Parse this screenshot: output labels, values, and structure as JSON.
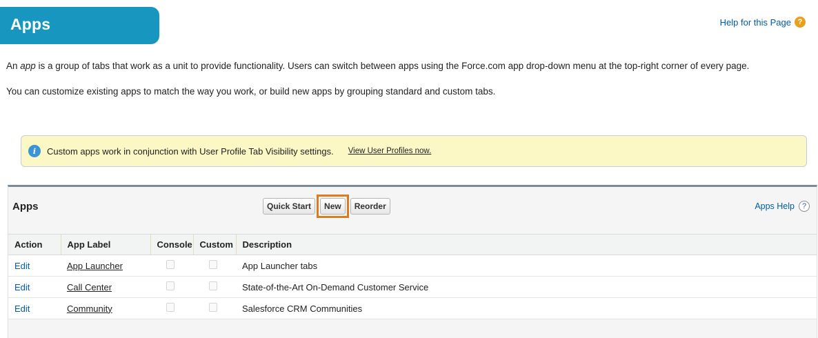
{
  "header": {
    "title": "Apps",
    "help_link": "Help for this Page",
    "help_icon": "question-orange-icon"
  },
  "intro": {
    "line1_prefix": "An ",
    "line1_em": "app",
    "line1_suffix": " is a group of tabs that work as a unit to provide functionality. Users can switch between apps using the Force.com app drop-down menu at the top-right corner of every page.",
    "line2": "You can customize existing apps to match the way you work, or build new apps by grouping standard and custom tabs."
  },
  "info": {
    "icon": "info-icon",
    "text": "Custom apps work in conjunction with User Profile Tab Visibility settings.",
    "link": "View User Profiles now."
  },
  "panel": {
    "title": "Apps",
    "buttons": {
      "quick_start": "Quick Start",
      "new": "New",
      "reorder": "Reorder"
    },
    "help_link": "Apps Help",
    "help_icon": "question-circle-icon",
    "highlight_color": "#e07a1f"
  },
  "table": {
    "columns": [
      "Action",
      "App Label",
      "Console",
      "Custom",
      "Description"
    ],
    "rows": [
      {
        "action": "Edit",
        "label": "App Launcher",
        "console": false,
        "custom": false,
        "description": "App Launcher tabs"
      },
      {
        "action": "Edit",
        "label": "Call Center",
        "console": false,
        "custom": false,
        "description": "State-of-the-Art On-Demand Customer Service"
      },
      {
        "action": "Edit",
        "label": "Community",
        "console": false,
        "custom": false,
        "description": "Salesforce CRM Communities"
      }
    ]
  },
  "colors": {
    "header_blue": "#1797c0",
    "link_blue": "#015ba7",
    "info_bg": "#fbf8c6"
  }
}
